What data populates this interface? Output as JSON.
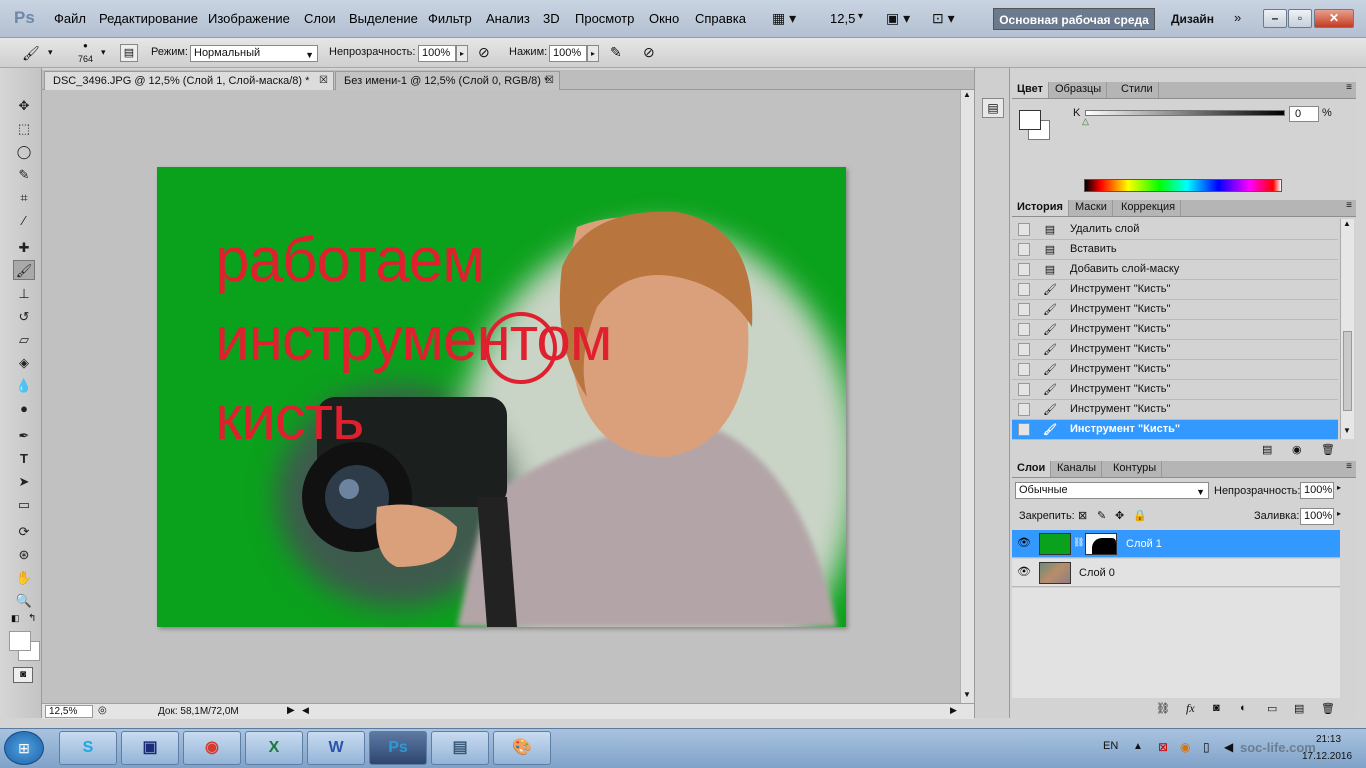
{
  "app": {
    "logo": "Ps",
    "workspace": "Основная рабочая среда",
    "design": "Дизайн",
    "zoom_menu": "12,5"
  },
  "menu": [
    "Файл",
    "Редактирование",
    "Изображение",
    "Слои",
    "Выделение",
    "Фильтр",
    "Анализ",
    "3D",
    "Просмотр",
    "Окно",
    "Справка"
  ],
  "options": {
    "brush_size": "764",
    "mode_label": "Режим:",
    "mode_value": "Нормальный",
    "opacity_label": "Непрозрачность:",
    "opacity_value": "100%",
    "flow_label": "Нажим:",
    "flow_value": "100%"
  },
  "tabs": [
    {
      "label": "DSC_3496.JPG @ 12,5% (Слой 1, Слой-маска/8) *",
      "active": true
    },
    {
      "label": "Без имени-1 @ 12,5% (Слой 0, RGB/8) *",
      "active": false
    }
  ],
  "canvas": {
    "line1": "работаем",
    "line2": "инструментом",
    "line3": "кисть",
    "bg_color": "#0aa11c",
    "text_color": "#e0202e"
  },
  "status": {
    "zoom": "12,5%",
    "doc": "Док: 58,1M/72,0M"
  },
  "color_panel": {
    "tabs": [
      "Цвет",
      "Образцы",
      "Стили"
    ],
    "channel": "K",
    "value": "0",
    "unit": "%"
  },
  "history_panel": {
    "tabs": [
      "История",
      "Маски",
      "Коррекция"
    ],
    "items": [
      {
        "label": "Удалить слой",
        "icon": "document-icon"
      },
      {
        "label": "Вставить",
        "icon": "document-icon"
      },
      {
        "label": "Добавить слой-маску",
        "icon": "document-icon"
      },
      {
        "label": "Инструмент \"Кисть\"",
        "icon": "brush-icon"
      },
      {
        "label": "Инструмент \"Кисть\"",
        "icon": "brush-icon"
      },
      {
        "label": "Инструмент \"Кисть\"",
        "icon": "brush-icon"
      },
      {
        "label": "Инструмент \"Кисть\"",
        "icon": "brush-icon"
      },
      {
        "label": "Инструмент \"Кисть\"",
        "icon": "brush-icon"
      },
      {
        "label": "Инструмент \"Кисть\"",
        "icon": "brush-icon"
      },
      {
        "label": "Инструмент \"Кисть\"",
        "icon": "brush-icon"
      },
      {
        "label": "Инструмент \"Кисть\"",
        "icon": "brush-icon",
        "selected": true
      }
    ]
  },
  "layers_panel": {
    "tabs": [
      "Слои",
      "Каналы",
      "Контуры"
    ],
    "blend": "Обычные",
    "opacity_label": "Непрозрачность:",
    "opacity_value": "100%",
    "lock_label": "Закрепить:",
    "fill_label": "Заливка:",
    "fill_value": "100%",
    "layers": [
      {
        "name": "Слой 1",
        "selected": true
      },
      {
        "name": "Слой 0",
        "selected": false
      }
    ]
  },
  "taskbar": {
    "lang": "EN",
    "time": "21:13",
    "date": "17.12.2016",
    "watermark": "soc-life.com"
  }
}
